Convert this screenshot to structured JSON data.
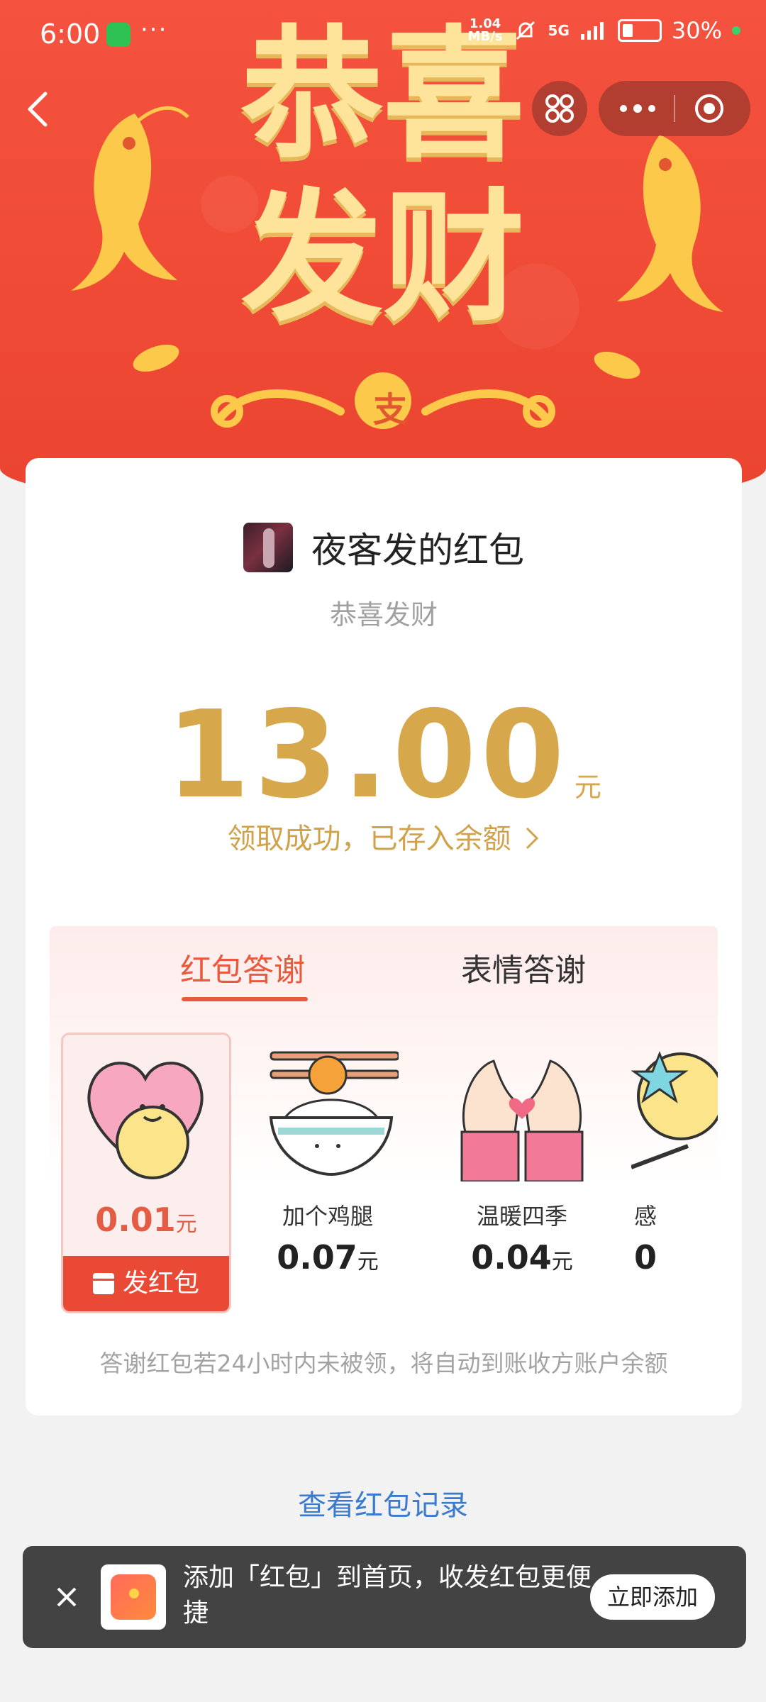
{
  "status_bar": {
    "time": "6:00",
    "dots": "···",
    "net_speed_top": "1.04",
    "net_speed_bottom": "MB/s",
    "network": "5G",
    "battery": "30%"
  },
  "banner": {
    "title_line1": "恭喜",
    "title_line2": "发财",
    "badge_char": "支"
  },
  "envelope": {
    "sender_name": "夜客发的红包",
    "greeting": "恭喜发财",
    "amount": "13.00",
    "amount_unit": "元",
    "received_text": "领取成功，已存入余额"
  },
  "thanks": {
    "tabs": [
      {
        "label": "红包答谢",
        "active": true
      },
      {
        "label": "表情答谢",
        "active": false
      }
    ],
    "items": [
      {
        "label": "",
        "price": "0.01",
        "unit": "元",
        "icon": "heart-hug-icon",
        "selected": true
      },
      {
        "label": "加个鸡腿",
        "price": "0.07",
        "unit": "元",
        "icon": "rice-bowl-drumstick-icon",
        "selected": false
      },
      {
        "label": "温暖四季",
        "price": "0.04",
        "unit": "元",
        "icon": "heart-hands-icon",
        "selected": false
      },
      {
        "label": "感",
        "price": "0",
        "unit": "",
        "icon": "star-sticker-icon",
        "selected": false
      }
    ],
    "send_button": "发红包",
    "note": "答谢红包若24小时内未被领，将自动到账收方账户余额"
  },
  "view_records": "查看红包记录",
  "toast": {
    "message": "添加「红包」到首页，收发红包更便捷",
    "button": "立即添加"
  },
  "colors": {
    "banner_red": "#f4533f",
    "gold": "#d6a84b",
    "accent_red": "#ea4a35",
    "link_blue": "#3a7bd0"
  }
}
